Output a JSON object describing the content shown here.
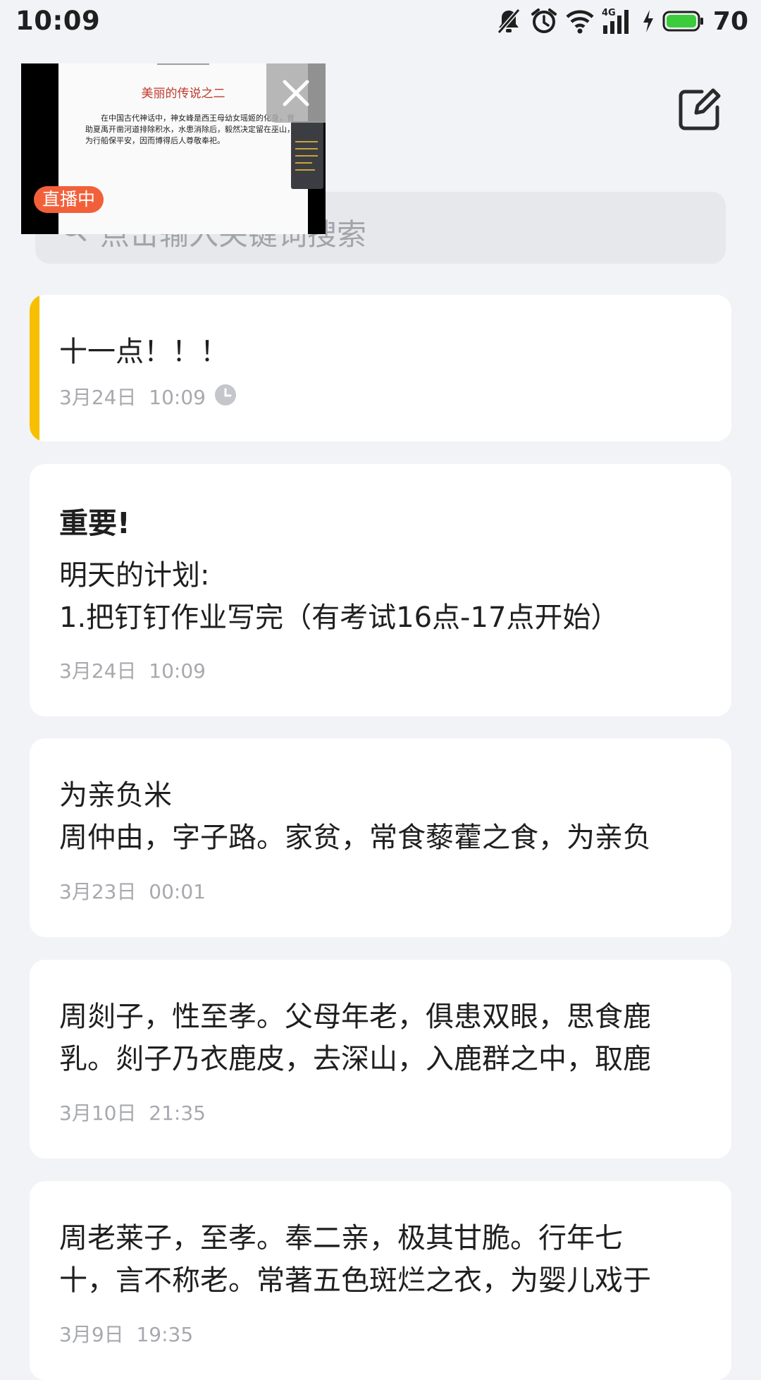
{
  "status_bar": {
    "time": "10:09",
    "battery": "70",
    "network": "4G",
    "icons": [
      "mute-icon",
      "alarm-icon",
      "wifi-icon",
      "signal-icon",
      "charging-icon",
      "battery-icon"
    ]
  },
  "pip": {
    "slide_title": "美丽的传说之二",
    "slide_text": "在中国古代神话中，神女峰是西王母幼女瑶姬的化身，曾助夏禹开凿河道排除积水，水患消除后，毅然决定留在巫山，为行船保平安，因而博得后人尊敬奉祀。",
    "live_badge": "直播中"
  },
  "search": {
    "placeholder": "点击输入关键词搜索"
  },
  "colors": {
    "background": "#f2f3f7",
    "pin_accent": "#f6c000",
    "live_badge": "#f2603a"
  },
  "notes": [
    {
      "title": "",
      "lines": [
        "十一点！！！"
      ],
      "date": "3月24日",
      "time": "10:09",
      "pinned": true,
      "has_reminder": true
    },
    {
      "title": "重要!",
      "lines": [
        "明天的计划:",
        "1.把钉钉作业写完（有考试16点-17点开始）"
      ],
      "date": "3月24日",
      "time": "10:09"
    },
    {
      "title": "",
      "lines": [
        "为亲负米",
        "周仲由，字子路。家贫，常食藜藿之食，为亲负"
      ],
      "date": "3月23日",
      "time": "00:01"
    },
    {
      "title": "",
      "lines": [
        "周剡子，性至孝。父母年老，俱患双眼，思食鹿",
        "乳。剡子乃衣鹿皮，去深山，入鹿群之中，取鹿"
      ],
      "date": "3月10日",
      "time": "21:35"
    },
    {
      "title": "",
      "lines": [
        "周老莱子，至孝。奉二亲，极其甘脆。行年七",
        "十，言不称老。常著五色斑烂之衣，为婴儿戏于"
      ],
      "date": "3月9日",
      "time": "19:35"
    }
  ]
}
